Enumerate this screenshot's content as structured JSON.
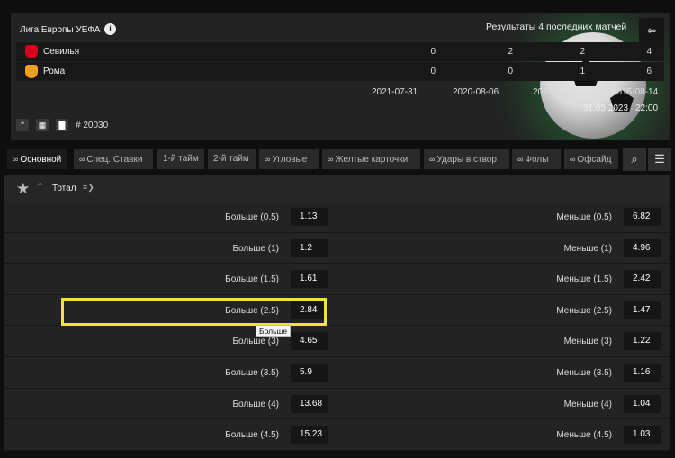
{
  "match": {
    "league": "Лига Европы УЕФА",
    "results_title": "Результаты 4 последних матчей",
    "teams": [
      {
        "name": "Севилья",
        "logo_color": "#d6001c",
        "scores": [
          "0",
          "2",
          "2",
          "4"
        ]
      },
      {
        "name": "Рома",
        "logo_color": "#f0a020",
        "scores": [
          "0",
          "0",
          "1",
          "6"
        ]
      }
    ],
    "dates": [
      "2021-07-31",
      "2020-08-06",
      "2017-08-10",
      "2015-08-14"
    ],
    "date": "31.05.2023",
    "time": "22:00",
    "match_id": "# 20030"
  },
  "tabs": [
    {
      "label": "Основной",
      "icon": "link-icon",
      "active": true
    },
    {
      "label": "Спец. Ставки",
      "icon": "link-icon"
    },
    {
      "label": "1-й тайм"
    },
    {
      "label": "2-й тайм"
    },
    {
      "label": "Угловые",
      "icon": "link-icon"
    },
    {
      "label": "Желтые карточки",
      "icon": "link-icon"
    },
    {
      "label": "Удары в створ",
      "icon": "link-icon"
    },
    {
      "label": "Фолы",
      "icon": "link-icon"
    },
    {
      "label": "Офсайд",
      "icon": "link-icon"
    }
  ],
  "market": {
    "title": "Тотал",
    "rows": [
      {
        "over_label": "Больше (0.5)",
        "over_odd": "1.13",
        "under_label": "Меньше (0.5)",
        "under_odd": "6.82"
      },
      {
        "over_label": "Больше (1)",
        "over_odd": "1.2",
        "under_label": "Меньше (1)",
        "under_odd": "4.96"
      },
      {
        "over_label": "Больше (1.5)",
        "over_odd": "1.61",
        "under_label": "Меньше (1.5)",
        "under_odd": "2.42"
      },
      {
        "over_label": "Больше (2.5)",
        "over_odd": "2.84",
        "under_label": "Меньше (2.5)",
        "under_odd": "1.47"
      },
      {
        "over_label": "Больше (3)",
        "over_odd": "4.65",
        "under_label": "Меньше (3)",
        "under_odd": "1.22"
      },
      {
        "over_label": "Больше (3.5)",
        "over_odd": "5.9",
        "under_label": "Меньше (3.5)",
        "under_odd": "1.16"
      },
      {
        "over_label": "Больше (4)",
        "over_odd": "13.68",
        "under_label": "Меньше (4)",
        "under_odd": "1.04"
      },
      {
        "over_label": "Больше (4.5)",
        "over_odd": "15.23",
        "under_label": "Меньше (4.5)",
        "under_odd": "1.03"
      }
    ],
    "tooltip": "Больше"
  },
  "colors": {
    "highlight": "#f0e43b",
    "accent_green": "#28a046"
  }
}
